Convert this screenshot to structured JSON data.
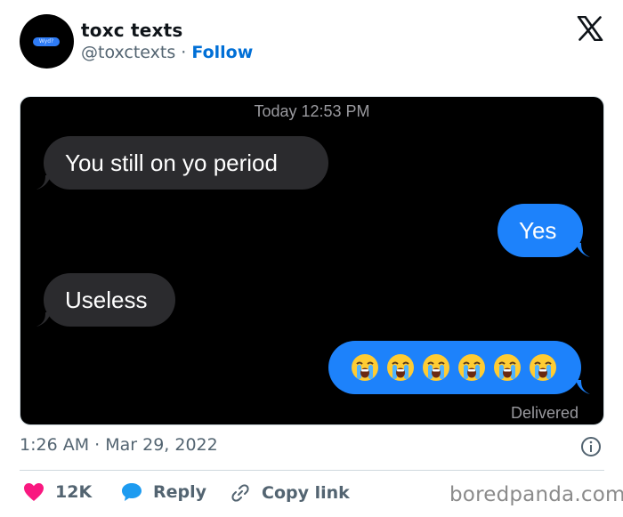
{
  "author": {
    "display_name": "toxc texts",
    "handle": "@toxctexts",
    "separator": "·",
    "follow_label": "Follow",
    "avatar_text": "Wyd?"
  },
  "screenshot": {
    "time_header": "Today 12:53 PM",
    "messages": [
      {
        "direction": "incoming",
        "text": "You still on yo period"
      },
      {
        "direction": "outgoing",
        "text": "Yes"
      },
      {
        "direction": "incoming",
        "text": "Useless"
      },
      {
        "direction": "outgoing",
        "text": "",
        "emoji": [
          "loudly-crying-face",
          "loudly-crying-face",
          "loudly-crying-face",
          "loudly-crying-face",
          "loudly-crying-face",
          "loudly-crying-face"
        ]
      }
    ],
    "status": "Delivered"
  },
  "post": {
    "timestamp": "1:26 AM · Mar 29, 2022"
  },
  "actions": {
    "like_count": "12K",
    "reply_label": "Reply",
    "copy_link_label": "Copy link"
  },
  "watermark": "boredpanda.com",
  "colors": {
    "like": "#f91880",
    "reply": "#1d9bf0",
    "follow": "#006fd6",
    "incoming_bubble": "#2b2b2e",
    "outgoing_bubble": "#1d82fb"
  },
  "icons": [
    "x-logo-icon",
    "info-icon",
    "heart-icon",
    "reply-bubble-icon",
    "link-icon",
    "loudly-crying-face-icon"
  ]
}
